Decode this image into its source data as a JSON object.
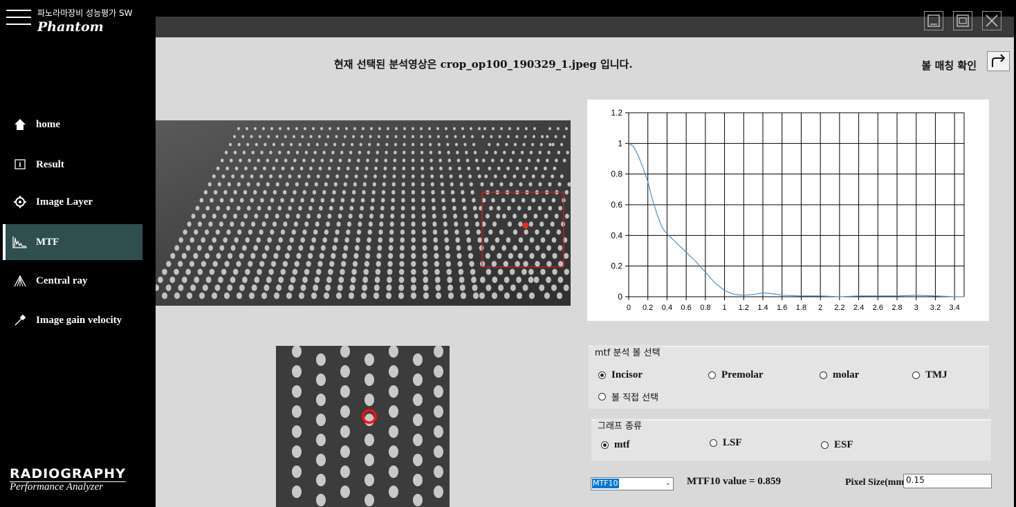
{
  "app": {
    "title": "파노라마장비 성능평가 SW",
    "logo": "Phantom",
    "brand_main": "RADIOGRAPHY",
    "brand_sub": "Performance Analyzer"
  },
  "sidebar": {
    "items": [
      {
        "label": "home",
        "icon": "home-icon"
      },
      {
        "label": "Result",
        "icon": "info-icon"
      },
      {
        "label": "Image Layer",
        "icon": "target-icon"
      },
      {
        "label": "MTF",
        "icon": "mtf-graph-icon",
        "active": true
      },
      {
        "label": "Central ray",
        "icon": "rays-icon"
      },
      {
        "label": "Image gain velocity",
        "icon": "pin-icon"
      }
    ]
  },
  "header": {
    "status_prefix": "현재 선택된 분석영상은 ",
    "status_file": "crop_op100_190329_1.jpeg",
    "status_suffix": " 입니다.",
    "ball_match_label": "볼 매칭 확인"
  },
  "chart_data": {
    "type": "line",
    "x_ticks": [
      "0",
      "0.2",
      "0.4",
      "0.6",
      "0.8",
      "1",
      "1.2",
      "1.4",
      "1.6",
      "1.8",
      "2",
      "2.2",
      "2.4",
      "2.6",
      "2.8",
      "3",
      "3.2",
      "3.4"
    ],
    "y_ticks": [
      "0",
      "0.2",
      "0.4",
      "0.6",
      "0.8",
      "1",
      "1.2"
    ],
    "xlim": [
      0,
      3.5
    ],
    "ylim": [
      0,
      1.2
    ],
    "grid": true,
    "series": [
      {
        "color": "#4a90c8",
        "x": [
          0,
          0.05,
          0.1,
          0.15,
          0.2,
          0.25,
          0.3,
          0.35,
          0.4,
          0.5,
          0.6,
          0.7,
          0.8,
          0.9,
          1.0,
          1.1,
          1.2,
          1.3,
          1.4,
          1.5,
          1.6,
          1.8,
          2.0,
          2.2,
          2.4,
          2.6,
          2.8,
          3.0,
          3.2,
          3.4,
          3.5
        ],
        "y": [
          1.0,
          0.98,
          0.92,
          0.84,
          0.75,
          0.63,
          0.53,
          0.45,
          0.41,
          0.35,
          0.29,
          0.23,
          0.16,
          0.09,
          0.04,
          0.015,
          0.01,
          0.015,
          0.025,
          0.02,
          0.01,
          0.005,
          0.005,
          0.0,
          0.005,
          0.005,
          0.005,
          0.01,
          0.005,
          0.0,
          0.0
        ]
      }
    ]
  },
  "ball_select": {
    "title": "mtf 분석 볼 선택",
    "options": [
      "Incisor",
      "Premolar",
      "molar",
      "TMJ",
      "볼 직접 선택"
    ],
    "selected": "Incisor"
  },
  "graph_type": {
    "title": "그래프 종류",
    "options": [
      "mtf",
      "LSF",
      "ESF"
    ],
    "selected": "mtf"
  },
  "controls": {
    "mtf_select_value": "MTF10",
    "mtf_value_text": "MTF10 value = 0.859",
    "pixel_size_label": "Pixel Size(mm)",
    "pixel_size_value": "0.15"
  }
}
